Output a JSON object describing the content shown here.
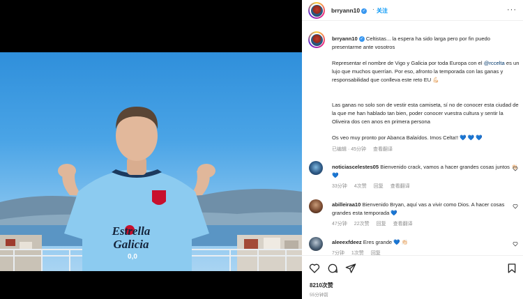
{
  "post": {
    "username": "brryann10",
    "follow_label": "关注",
    "more_label": "···"
  },
  "caption": {
    "username": "brryann10",
    "line1": "Celtistas... la espera ha sido larga pero por fin puedo presentarme ante vosotros",
    "p2_before": "Representar el nombre de Vigo y Galicia por toda Europa con el ",
    "p2_link": "@rccelta",
    "p2_after": " es un lujo que muchos querrían. Por eso, afronto la temporada con las ganas y responsabilidad que conlleva este reto EU 💪🏻",
    "p3": "Las ganas no solo son de vestir esta camiseta, sí no de conocer esta ciudad de la que me han hablado tan bien, poder conocer vuestra cultura y sentir la Oliveira dos cen anos en primera persona",
    "p4": "Os veo muy pronto por Abanca Balaídos. Imos Celta!! 💙 💙 💙",
    "edited": "已编辑 · 45分钟",
    "translate": "查看翻译"
  },
  "comments": [
    {
      "username": "noticiascelestes05",
      "text": "Bienvenido crack, vamos a hacer grandes cosas juntos 👏🏻💙",
      "time": "33分钟",
      "likes": "4次赞",
      "reply": "回复",
      "translate": "查看翻译"
    },
    {
      "username": "abilleiraa10",
      "text": "Bienvenido Bryan, aquí vas a vivir como Dios. A hacer cosas grandes esta temporada 💙",
      "time": "47分钟",
      "likes": "22次赞",
      "reply": "回复",
      "translate": "查看翻译"
    },
    {
      "username": "aleeexfdeez",
      "text": "Eres grande 💙 👏🏻",
      "time": "7分钟",
      "likes": "1次赞",
      "reply": "回复",
      "translate": ""
    }
  ],
  "footer": {
    "likes": "8210次赞",
    "time": "55分钟前"
  },
  "photo": {
    "sponsor_line1": "Estrella",
    "sponsor_line2": "Galicia",
    "sponsor_line3": "0,0"
  },
  "colors": {
    "link": "#00376b",
    "follow": "#0095f6",
    "verified": "#3897f0",
    "jersey": "#8ccbf0"
  },
  "icons": [
    "heart-icon",
    "comment-icon",
    "share-icon",
    "bookmark-icon",
    "verified-icon",
    "more-icon"
  ]
}
